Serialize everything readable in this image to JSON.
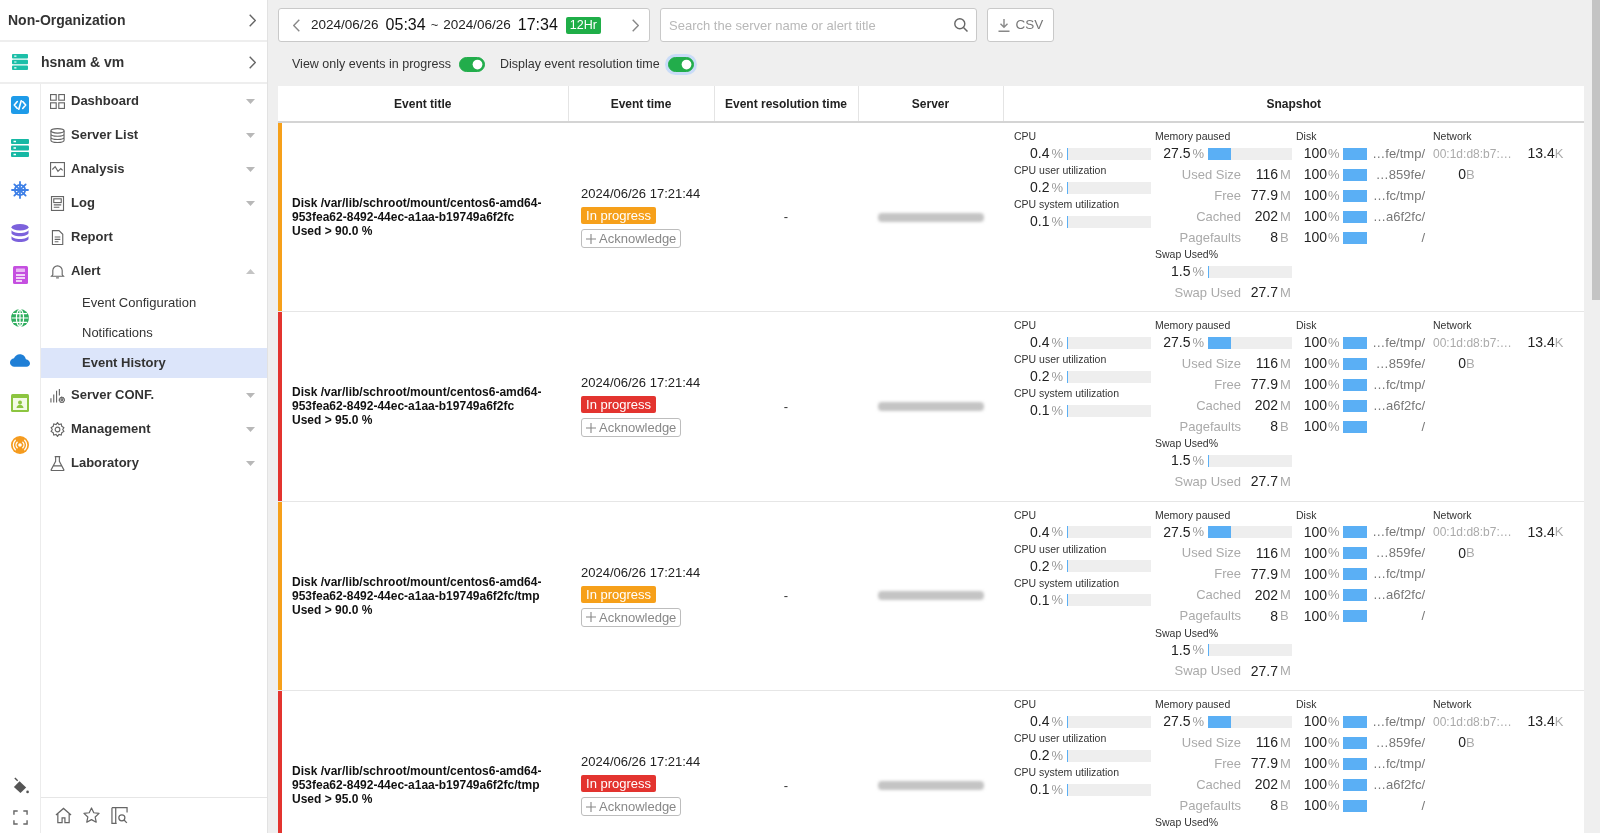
{
  "sidebar": {
    "organization": "Non-Organization",
    "project": "hsnam & vm",
    "menu": [
      {
        "label": "Dashboard",
        "expanded": false
      },
      {
        "label": "Server List",
        "expanded": false
      },
      {
        "label": "Analysis",
        "expanded": false
      },
      {
        "label": "Log",
        "expanded": false
      },
      {
        "label": "Report"
      },
      {
        "label": "Alert",
        "expanded": true,
        "children": [
          {
            "label": "Event Configuration",
            "selected": false
          },
          {
            "label": "Notifications",
            "selected": false
          },
          {
            "label": "Event History",
            "selected": true
          }
        ]
      },
      {
        "label": "Server CONF.",
        "expanded": false
      },
      {
        "label": "Management",
        "expanded": false
      },
      {
        "label": "Laboratory",
        "expanded": false
      }
    ]
  },
  "toolbar": {
    "date_range": {
      "start_date": "2024/06/26",
      "start_time": "05:34",
      "separator": "~",
      "end_date": "2024/06/26",
      "end_time": "17:34",
      "span": "12Hr"
    },
    "search": {
      "placeholder": "Search the server name or alert title"
    },
    "export_button": "CSV"
  },
  "filters": [
    {
      "label": "View only events in progress",
      "on": true,
      "focused": false
    },
    {
      "label": "Display event resolution time",
      "on": true,
      "focused": true
    }
  ],
  "table": {
    "columns": [
      "Event title",
      "Event time",
      "Event resolution time",
      "Server",
      "Snapshot"
    ],
    "rows": [
      {
        "color": "#f6a01a",
        "title": "Disk /var/lib/schroot/mount/centos6-amd64-\n953fea62-8492-44ec-a1aa-b19749a6f2fc\nUsed > 90.0 %",
        "time": "2024/06/26 17:21:44",
        "status": "In progress",
        "action": "Acknowledge",
        "resolution_time": "-",
        "server_redacted": true,
        "snapshot": {
          "cpu": [
            {
              "label": "CPU",
              "value": "0.4",
              "unit": "%",
              "level": 0.004
            },
            {
              "label": "CPU user utilization",
              "value": "0.2",
              "unit": "%",
              "level": 0.002
            },
            {
              "label": "CPU system utilization",
              "value": "0.1",
              "unit": "%",
              "level": 0.001
            }
          ],
          "memory": {
            "label": "Memory paused",
            "value": "27.5",
            "unit": "%",
            "level": 0.275,
            "details": [
              {
                "label": "Used Size",
                "value": "116",
                "unit": "M"
              },
              {
                "label": "Free",
                "value": "77.9",
                "unit": "M"
              },
              {
                "label": "Cached",
                "value": "202",
                "unit": "M"
              },
              {
                "label": "Pagefaults",
                "value": "8",
                "unit": "B"
              }
            ],
            "swap": {
              "label": "Swap Used%",
              "value": "1.5",
              "unit": "%",
              "level": 0.015,
              "details": [
                {
                  "label": "Swap Used",
                  "value": "27.7",
                  "unit": "M"
                }
              ]
            }
          },
          "disk": {
            "label": "Disk",
            "items": [
              {
                "value": "100",
                "unit": "%",
                "level": 1,
                "path": "…fe/tmp/"
              },
              {
                "value": "100",
                "unit": "%",
                "level": 1,
                "path": "…859fe/"
              },
              {
                "value": "100",
                "unit": "%",
                "level": 1,
                "path": "…fc/tmp/"
              },
              {
                "value": "100",
                "unit": "%",
                "level": 1,
                "path": "…a6f2fc/"
              },
              {
                "value": "100",
                "unit": "%",
                "level": 1,
                "path": "/"
              }
            ]
          },
          "network": {
            "label": "Network",
            "items": [
              {
                "name": "00:1d:d8:b7:…",
                "value": "13.4",
                "unit": "K"
              },
              {
                "value": "0",
                "unit": "B"
              }
            ]
          }
        }
      },
      {
        "color": "#e3342f",
        "title": "Disk /var/lib/schroot/mount/centos6-amd64-\n953fea62-8492-44ec-a1aa-b19749a6f2fc\nUsed > 95.0 %",
        "time": "2024/06/26 17:21:44",
        "status": "In progress",
        "action": "Acknowledge",
        "resolution_time": "-",
        "server_redacted": true,
        "snapshot": {
          "cpu": [
            {
              "label": "CPU",
              "value": "0.4",
              "unit": "%",
              "level": 0.004
            },
            {
              "label": "CPU user utilization",
              "value": "0.2",
              "unit": "%",
              "level": 0.002
            },
            {
              "label": "CPU system utilization",
              "value": "0.1",
              "unit": "%",
              "level": 0.001
            }
          ],
          "memory": {
            "label": "Memory paused",
            "value": "27.5",
            "unit": "%",
            "level": 0.275,
            "details": [
              {
                "label": "Used Size",
                "value": "116",
                "unit": "M"
              },
              {
                "label": "Free",
                "value": "77.9",
                "unit": "M"
              },
              {
                "label": "Cached",
                "value": "202",
                "unit": "M"
              },
              {
                "label": "Pagefaults",
                "value": "8",
                "unit": "B"
              }
            ],
            "swap": {
              "label": "Swap Used%",
              "value": "1.5",
              "unit": "%",
              "level": 0.015,
              "details": [
                {
                  "label": "Swap Used",
                  "value": "27.7",
                  "unit": "M"
                }
              ]
            }
          },
          "disk": {
            "label": "Disk",
            "items": [
              {
                "value": "100",
                "unit": "%",
                "level": 1,
                "path": "…fe/tmp/"
              },
              {
                "value": "100",
                "unit": "%",
                "level": 1,
                "path": "…859fe/"
              },
              {
                "value": "100",
                "unit": "%",
                "level": 1,
                "path": "…fc/tmp/"
              },
              {
                "value": "100",
                "unit": "%",
                "level": 1,
                "path": "…a6f2fc/"
              },
              {
                "value": "100",
                "unit": "%",
                "level": 1,
                "path": "/"
              }
            ]
          },
          "network": {
            "label": "Network",
            "items": [
              {
                "name": "00:1d:d8:b7:…",
                "value": "13.4",
                "unit": "K"
              },
              {
                "value": "0",
                "unit": "B"
              }
            ]
          }
        }
      },
      {
        "color": "#f6a01a",
        "title": "Disk /var/lib/schroot/mount/centos6-amd64-\n953fea62-8492-44ec-a1aa-b19749a6f2fc/tmp\nUsed > 90.0 %",
        "time": "2024/06/26 17:21:44",
        "status": "In progress",
        "action": "Acknowledge",
        "resolution_time": "-",
        "server_redacted": true,
        "snapshot": {
          "cpu": [
            {
              "label": "CPU",
              "value": "0.4",
              "unit": "%",
              "level": 0.004
            },
            {
              "label": "CPU user utilization",
              "value": "0.2",
              "unit": "%",
              "level": 0.002
            },
            {
              "label": "CPU system utilization",
              "value": "0.1",
              "unit": "%",
              "level": 0.001
            }
          ],
          "memory": {
            "label": "Memory paused",
            "value": "27.5",
            "unit": "%",
            "level": 0.275,
            "details": [
              {
                "label": "Used Size",
                "value": "116",
                "unit": "M"
              },
              {
                "label": "Free",
                "value": "77.9",
                "unit": "M"
              },
              {
                "label": "Cached",
                "value": "202",
                "unit": "M"
              },
              {
                "label": "Pagefaults",
                "value": "8",
                "unit": "B"
              }
            ],
            "swap": {
              "label": "Swap Used%",
              "value": "1.5",
              "unit": "%",
              "level": 0.015,
              "details": [
                {
                  "label": "Swap Used",
                  "value": "27.7",
                  "unit": "M"
                }
              ]
            }
          },
          "disk": {
            "label": "Disk",
            "items": [
              {
                "value": "100",
                "unit": "%",
                "level": 1,
                "path": "…fe/tmp/"
              },
              {
                "value": "100",
                "unit": "%",
                "level": 1,
                "path": "…859fe/"
              },
              {
                "value": "100",
                "unit": "%",
                "level": 1,
                "path": "…fc/tmp/"
              },
              {
                "value": "100",
                "unit": "%",
                "level": 1,
                "path": "…a6f2fc/"
              },
              {
                "value": "100",
                "unit": "%",
                "level": 1,
                "path": "/"
              }
            ]
          },
          "network": {
            "label": "Network",
            "items": [
              {
                "name": "00:1d:d8:b7:…",
                "value": "13.4",
                "unit": "K"
              },
              {
                "value": "0",
                "unit": "B"
              }
            ]
          }
        }
      },
      {
        "color": "#e3342f",
        "title": "Disk /var/lib/schroot/mount/centos6-amd64-\n953fea62-8492-44ec-a1aa-b19749a6f2fc/tmp\nUsed > 95.0 %",
        "time": "2024/06/26 17:21:44",
        "status": "In progress",
        "action": "Acknowledge",
        "resolution_time": "-",
        "server_redacted": true,
        "snapshot": {
          "cpu": [
            {
              "label": "CPU",
              "value": "0.4",
              "unit": "%",
              "level": 0.004
            },
            {
              "label": "CPU user utilization",
              "value": "0.2",
              "unit": "%",
              "level": 0.002
            },
            {
              "label": "CPU system utilization",
              "value": "0.1",
              "unit": "%",
              "level": 0.001
            }
          ],
          "memory": {
            "label": "Memory paused",
            "value": "27.5",
            "unit": "%",
            "level": 0.275,
            "details": [
              {
                "label": "Used Size",
                "value": "116",
                "unit": "M"
              },
              {
                "label": "Free",
                "value": "77.9",
                "unit": "M"
              },
              {
                "label": "Cached",
                "value": "202",
                "unit": "M"
              },
              {
                "label": "Pagefaults",
                "value": "8",
                "unit": "B"
              }
            ],
            "swap": {
              "label": "Swap Used%"
            }
          },
          "disk": {
            "label": "Disk",
            "items": [
              {
                "value": "100",
                "unit": "%",
                "level": 1,
                "path": "…fe/tmp/"
              },
              {
                "value": "100",
                "unit": "%",
                "level": 1,
                "path": "…859fe/"
              },
              {
                "value": "100",
                "unit": "%",
                "level": 1,
                "path": "…fc/tmp/"
              },
              {
                "value": "100",
                "unit": "%",
                "level": 1,
                "path": "…a6f2fc/"
              },
              {
                "value": "100",
                "unit": "%",
                "level": 1,
                "path": "/"
              }
            ]
          },
          "network": {
            "label": "Network",
            "items": [
              {
                "name": "00:1d:d8:b7:…",
                "value": "13.4",
                "unit": "K"
              },
              {
                "value": "0",
                "unit": "B"
              }
            ]
          }
        }
      }
    ]
  }
}
